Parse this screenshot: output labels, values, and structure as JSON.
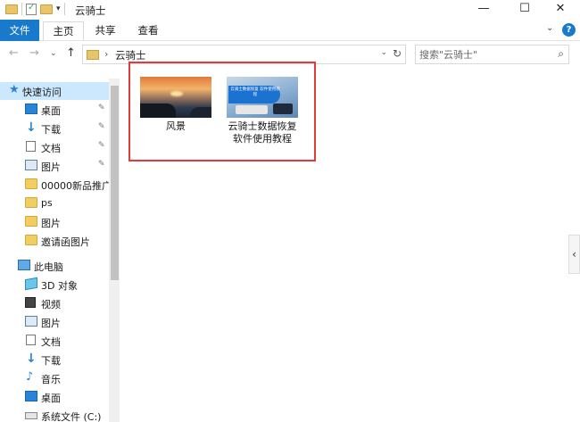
{
  "window": {
    "title": "云骑士",
    "minimize": "—",
    "maximize": "☐",
    "close": "✕"
  },
  "ribbon": {
    "tabs": [
      "文件",
      "主页",
      "共享",
      "查看"
    ],
    "expand": "⌄",
    "help": "?"
  },
  "address": {
    "back": "←",
    "forward": "→",
    "recent": "⌄",
    "up": "↑",
    "separator": "›",
    "path": "云骑士",
    "dropdown": "⌄",
    "refresh": "↻"
  },
  "search": {
    "placeholder": "搜索\"云骑士\"",
    "icon": "search-icon"
  },
  "sidebar": {
    "items": [
      {
        "label": "快速访问",
        "icon": "star-icon",
        "pinned": false
      },
      {
        "label": "桌面",
        "icon": "desktop-icon",
        "pinned": true
      },
      {
        "label": "下载",
        "icon": "download-icon",
        "pinned": true
      },
      {
        "label": "文档",
        "icon": "document-icon",
        "pinned": true
      },
      {
        "label": "图片",
        "icon": "picture-icon",
        "pinned": true
      },
      {
        "label": "00000新品推广;",
        "icon": "folder-icon",
        "pinned": false
      },
      {
        "label": "ps",
        "icon": "folder-icon",
        "pinned": false
      },
      {
        "label": "图片",
        "icon": "folder-icon",
        "pinned": false
      },
      {
        "label": "邀请函图片",
        "icon": "folder-icon",
        "pinned": false
      },
      {
        "label": "此电脑",
        "icon": "computer-icon",
        "pinned": false
      },
      {
        "label": "3D 对象",
        "icon": "3d-objects-icon",
        "pinned": false
      },
      {
        "label": "视频",
        "icon": "video-icon",
        "pinned": false
      },
      {
        "label": "图片",
        "icon": "picture-icon",
        "pinned": false
      },
      {
        "label": "文档",
        "icon": "document-icon",
        "pinned": false
      },
      {
        "label": "下载",
        "icon": "download-icon",
        "pinned": false
      },
      {
        "label": "音乐",
        "icon": "music-icon",
        "pinned": false
      },
      {
        "label": "桌面",
        "icon": "desktop-icon",
        "pinned": false
      },
      {
        "label": "系统文件 (C:)",
        "icon": "drive-icon",
        "pinned": false
      }
    ],
    "pin_glyph": "📌"
  },
  "files": [
    {
      "name": "风景",
      "thumbnail": "landscape-photo"
    },
    {
      "name": "云骑士数据恢复\n软件使用教程",
      "line1": "云骑士数据恢复",
      "line2": "软件使用教程",
      "thumbnail": "tutorial-image",
      "thumb_text": "云骑士数据恢复 软件使用教程"
    }
  ],
  "colors": {
    "accent": "#1979ca",
    "selection": "#cce8ff",
    "highlight_box": "#e23b3b"
  },
  "details_pane_toggle": "‹"
}
